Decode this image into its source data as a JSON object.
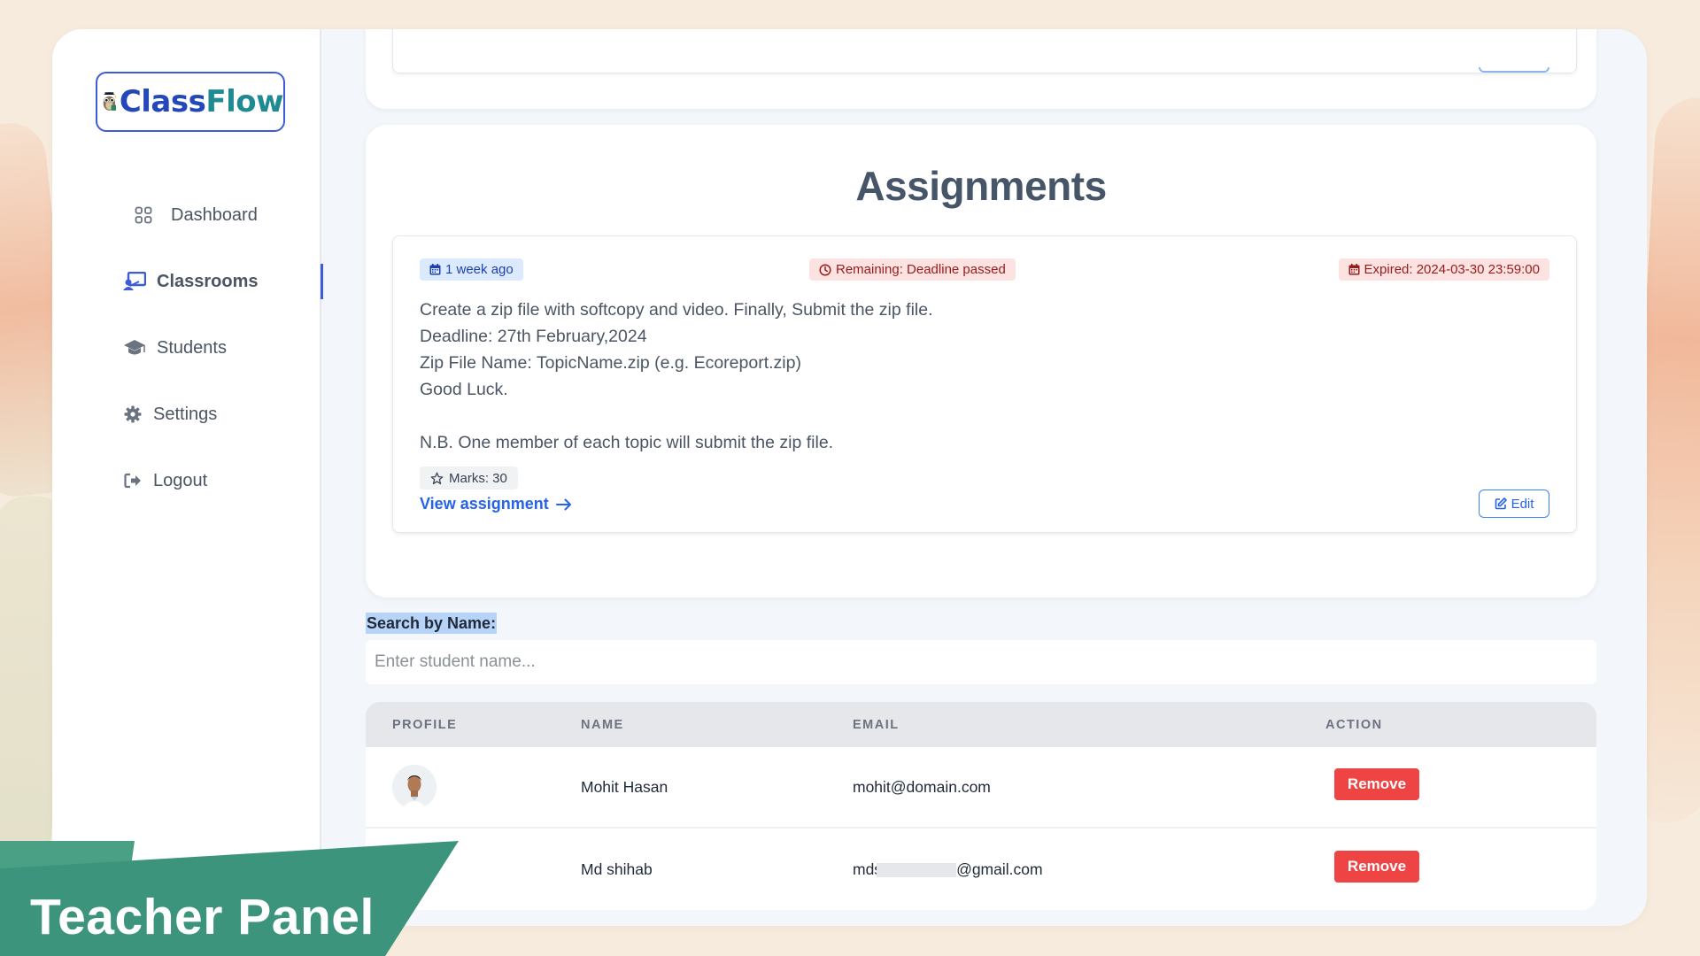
{
  "app": {
    "logo_text_a": "Class",
    "logo_text_b": "Flow",
    "logo_alt": "ClassFlow"
  },
  "sidebar": {
    "items": [
      {
        "label": "Dashboard",
        "icon": "grid-icon",
        "active": false
      },
      {
        "label": "Classrooms",
        "icon": "classroom-icon",
        "active": true
      },
      {
        "label": "Students",
        "icon": "graduation-cap-icon",
        "active": false
      },
      {
        "label": "Settings",
        "icon": "gear-icon",
        "active": false
      },
      {
        "label": "Logout",
        "icon": "logout-icon",
        "active": false
      }
    ]
  },
  "assignments": {
    "title": "Assignments",
    "item": {
      "posted": "1 week ago",
      "remaining": "Remaining: Deadline passed",
      "expired": "Expired: 2024-03-30 23:59:00",
      "description_lines": [
        "Create a zip file with softcopy and video. Finally, Submit the zip file.",
        "Deadline: 27th February,2024",
        "Zip File Name: TopicName.zip (e.g. Ecoreport.zip)",
        "Good Luck.",
        "",
        "N.B. One member of each topic will submit the zip file."
      ],
      "marks": "Marks: 30",
      "view_link": "View assignment",
      "edit_label": "Edit"
    }
  },
  "search": {
    "label": "Search by Name:",
    "placeholder": "Enter student name..."
  },
  "students_table": {
    "headers": [
      "PROFILE",
      "NAME",
      "EMAIL",
      "ACTION"
    ],
    "rows": [
      {
        "name": "Mohit Hasan",
        "email": "mohit@domain.com",
        "action": "Remove"
      },
      {
        "name": "Md shihab",
        "email_prefix": "mds",
        "email_suffix": "@gmail.com",
        "action": "Remove"
      }
    ]
  },
  "banner": {
    "text": "Teacher Panel"
  },
  "colors": {
    "accent": "#3d5bd9",
    "remove": "#ef4444",
    "banner": "#3d947c",
    "link": "#2563eb"
  }
}
